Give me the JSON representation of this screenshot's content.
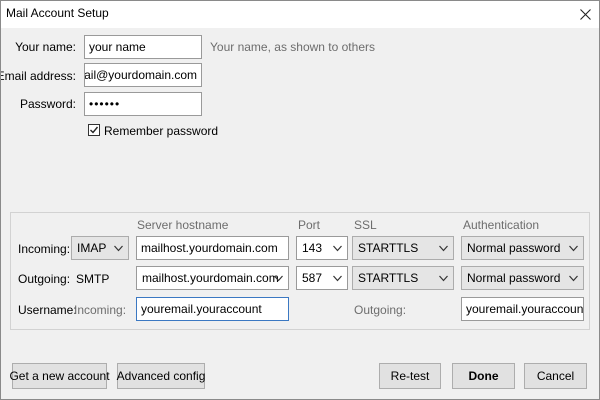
{
  "window": {
    "title": "Mail Account Setup"
  },
  "form": {
    "name_label": "Your name:",
    "name_value": "your name",
    "name_hint": "Your name, as shown to others",
    "email_label": "Email address:",
    "email_value": "email@yourdomain.com",
    "password_label": "Password:",
    "password_value": "••••••",
    "remember_label": "Remember password",
    "remember_checked": true
  },
  "server": {
    "headers": {
      "hostname": "Server hostname",
      "port": "Port",
      "ssl": "SSL",
      "auth": "Authentication"
    },
    "incoming": {
      "label": "Incoming:",
      "protocol": "IMAP",
      "hostname": "mailhost.yourdomain.com",
      "port": "143",
      "ssl": "STARTTLS",
      "auth": "Normal password"
    },
    "outgoing": {
      "label": "Outgoing:",
      "protocol": "SMTP",
      "hostname": "mailhost.yourdomain.com",
      "port": "587",
      "ssl": "STARTTLS",
      "auth": "Normal password"
    },
    "username": {
      "label": "Username:",
      "incoming_label": "Incoming:",
      "incoming_value": "youremail.youraccount",
      "outgoing_label": "Outgoing:",
      "outgoing_value": "youremail.youraccount"
    }
  },
  "buttons": {
    "new_account": "Get a new account",
    "advanced": "Advanced config",
    "retest": "Re-test",
    "done": "Done",
    "cancel": "Cancel"
  }
}
